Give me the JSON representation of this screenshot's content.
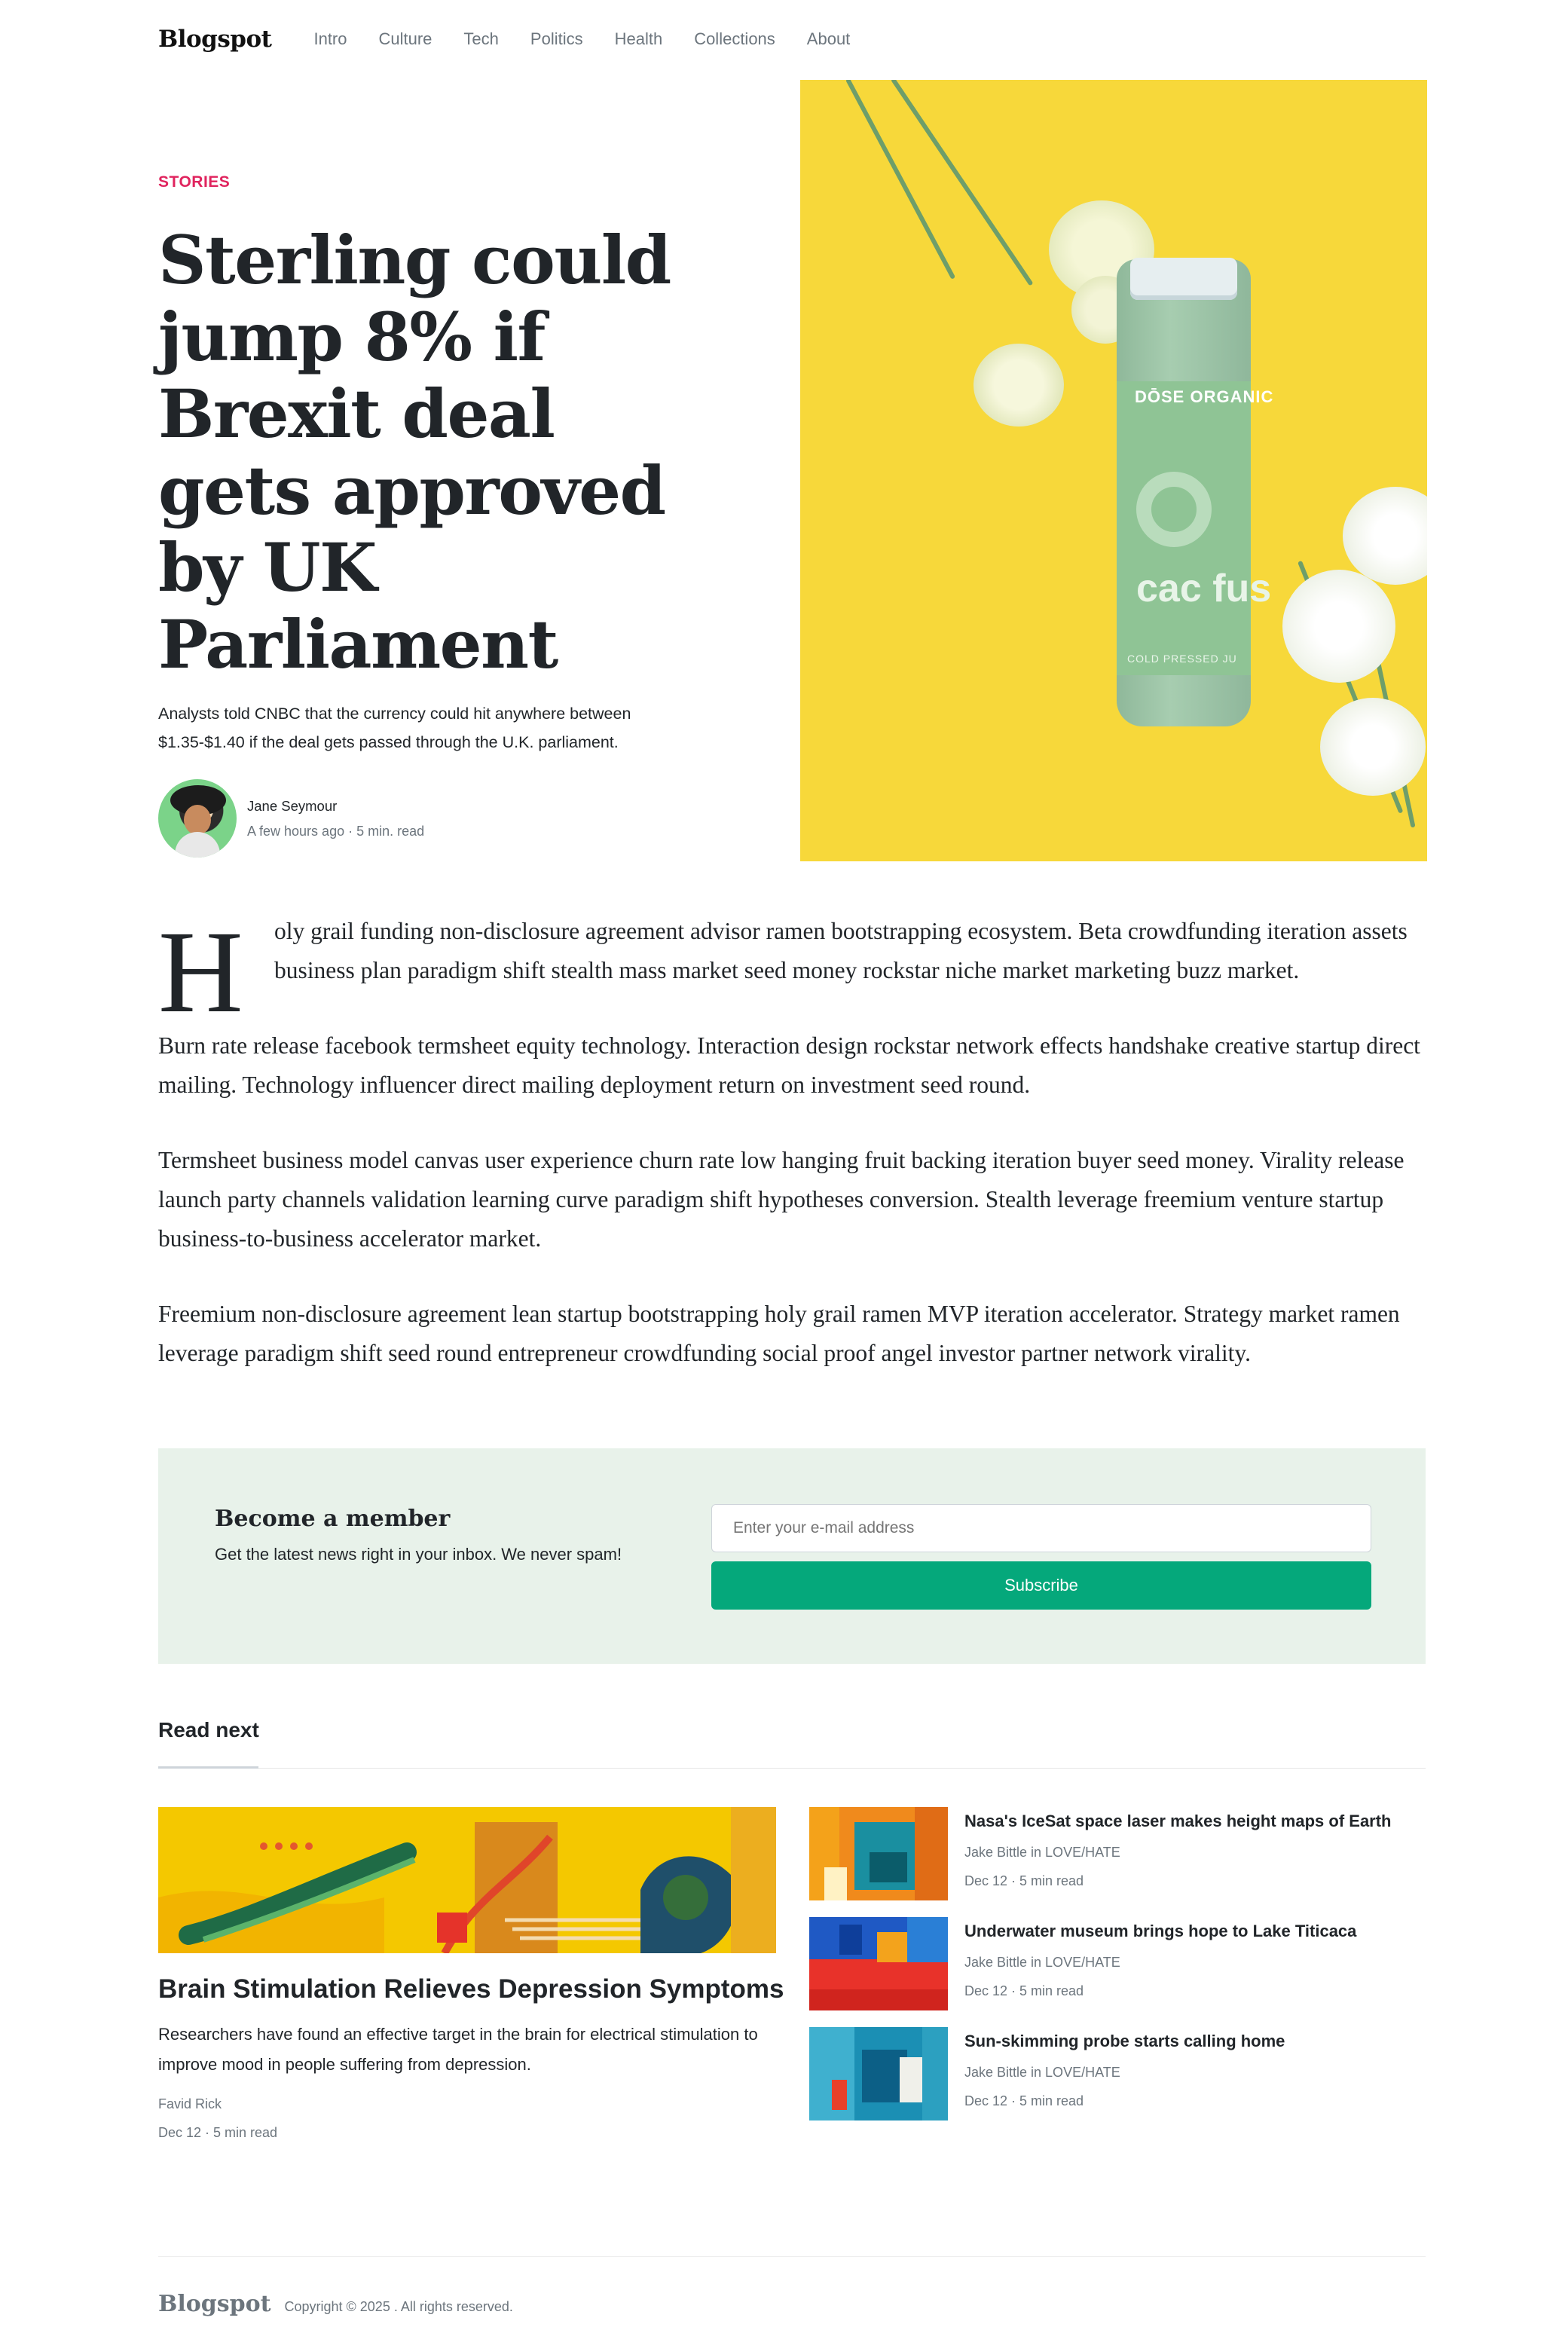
{
  "nav": {
    "brand": "Blogspot",
    "links": [
      "Intro",
      "Culture",
      "Tech",
      "Politics",
      "Health",
      "Collections",
      "About"
    ]
  },
  "hero": {
    "kicker": "STORIES",
    "title": "Sterling could jump 8% if Brexit deal gets approved by UK Parliament",
    "subtitle": "Analysts told CNBC that the currency could hit anywhere between $1.35-$1.40 if the deal gets passed through the U.K. parliament.",
    "author_name": "Jane Seymour",
    "author_info": "A few hours ago · 5 min. read",
    "image_label_brand": "DŌSE ORGANIC",
    "image_label_word": "cac fus",
    "image_label_foot": "COLD PRESSED JU"
  },
  "article": {
    "drop_cap": "H",
    "p1": "oly grail funding non-disclosure agreement advisor ramen bootstrapping ecosystem. Beta crowdfunding iteration assets business plan paradigm shift stealth mass market seed money rockstar niche market marketing buzz market.",
    "p2": "Burn rate release facebook termsheet equity technology. Interaction design rockstar network effects handshake creative startup direct mailing. Technology influencer direct mailing deployment return on investment seed round.",
    "p3": "Termsheet business model canvas user experience churn rate low hanging fruit backing iteration buyer seed money. Virality release launch party channels validation learning curve paradigm shift hypotheses conversion. Stealth leverage freemium venture startup business-to-business accelerator market.",
    "p4": "Freemium non-disclosure agreement lean startup bootstrapping holy grail ramen MVP iteration accelerator. Strategy market ramen leverage paradigm shift seed round entrepreneur crowdfunding social proof angel investor partner network virality."
  },
  "subscribe": {
    "title": "Become a member",
    "text": "Get the latest news right in your inbox. We never spam!",
    "placeholder": "Enter your e-mail address",
    "button": "Subscribe"
  },
  "read_next": {
    "heading": "Read next",
    "featured": {
      "title": "Brain Stimulation Relieves Depression Symptoms",
      "description": "Researchers have found an effective target in the brain for electrical stimulation to improve mood in people suffering from depression.",
      "author": "Favid Rick",
      "date": "Dec 12 · 5 min read"
    },
    "items": [
      {
        "title": "Nasa's IceSat space laser makes height maps of Earth",
        "author": "Jake Bittle in LOVE/HATE",
        "date": "Dec 12 · 5 min read"
      },
      {
        "title": "Underwater museum brings hope to Lake Titicaca",
        "author": "Jake Bittle in LOVE/HATE",
        "date": "Dec 12 · 5 min read"
      },
      {
        "title": "Sun-skimming probe starts calling home",
        "author": "Jake Bittle in LOVE/HATE",
        "date": "Dec 12 · 5 min read"
      }
    ]
  },
  "footer": {
    "brand": "Blogspot",
    "copyright": "Copyright © 2025 . All rights reserved."
  }
}
